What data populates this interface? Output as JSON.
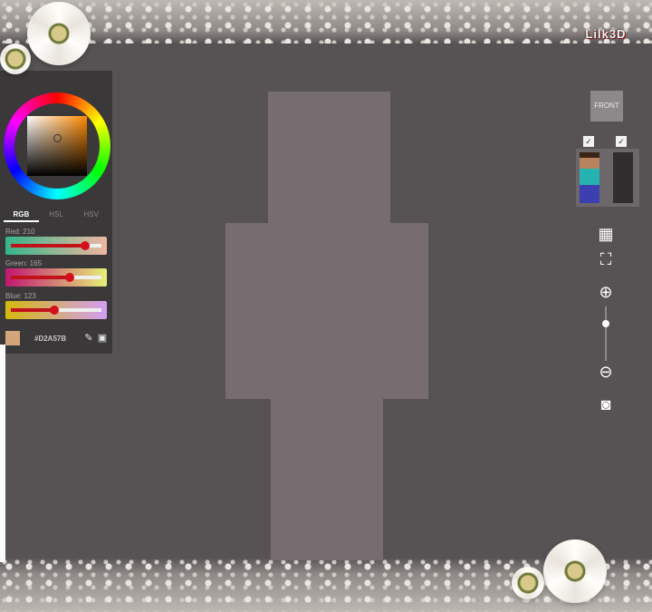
{
  "watermark": "Lilk3D",
  "color_picker": {
    "tabs": [
      {
        "label": "RGB",
        "active": true
      },
      {
        "label": "HSL",
        "active": false
      },
      {
        "label": "HSV",
        "active": false
      }
    ],
    "sliders": [
      {
        "label": "Red: 210",
        "value": 210,
        "max": 255
      },
      {
        "label": "Green: 165",
        "value": 165,
        "max": 255
      },
      {
        "label": "Blue: 123",
        "value": 123,
        "max": 255
      }
    ],
    "hex": "#D2A57B",
    "current_color": "#d2a57b",
    "icons": [
      "eyedropper-icon",
      "palette-icon"
    ]
  },
  "toolbar": {
    "view_label": "FRONT",
    "layer_toggles": [
      true,
      true
    ],
    "icons": [
      "grid-icon",
      "focus-icon",
      "zoom-in-icon",
      "zoom-out-icon",
      "camera-icon"
    ],
    "zoom_level": 0.68
  },
  "canvas": {
    "skin_color": "#776c6f"
  }
}
